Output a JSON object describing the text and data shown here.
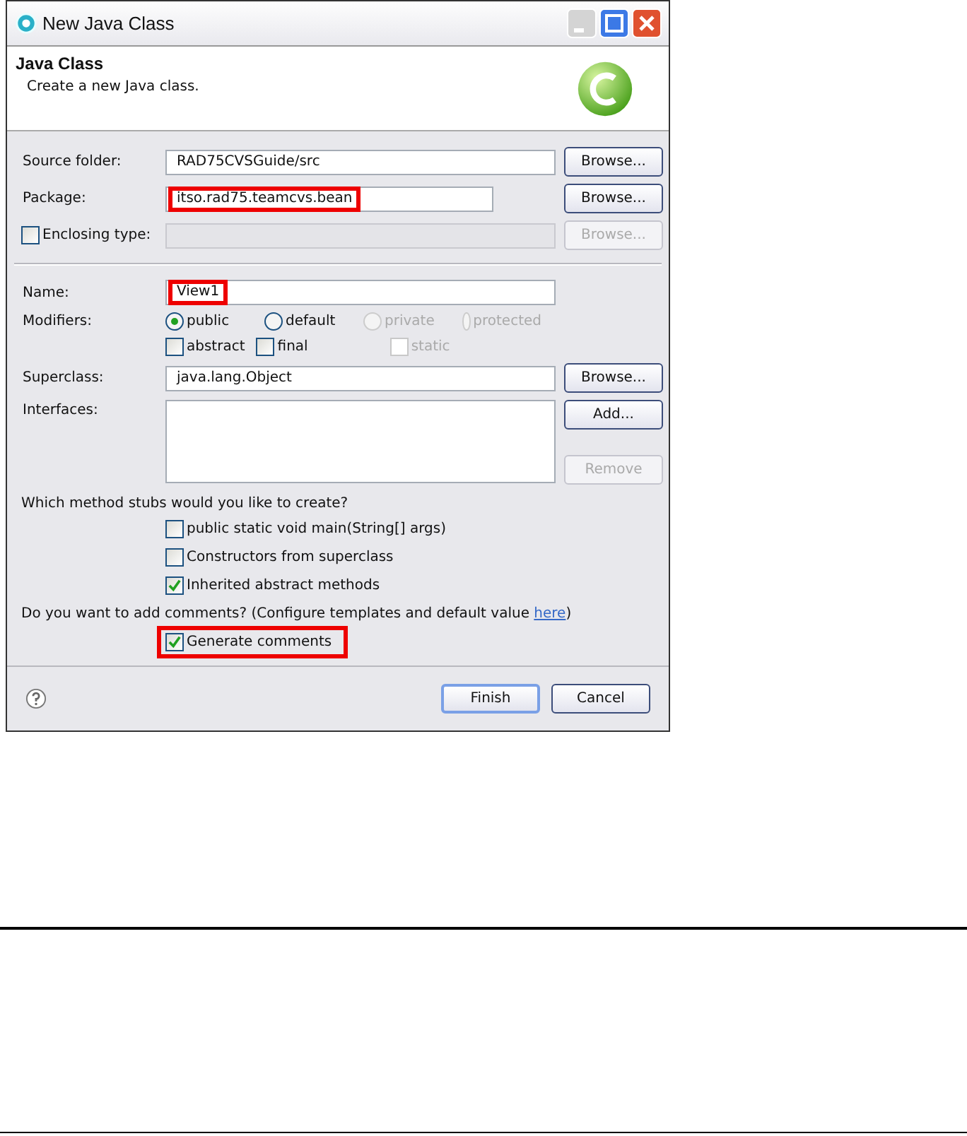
{
  "window": {
    "title": "New Java Class"
  },
  "header": {
    "title": "Java Class",
    "description": "Create a new Java class."
  },
  "location_fields": [
    {
      "kind": "text",
      "label": "Source folder:",
      "value": "RAD75CVSGuide/src",
      "highlighted": false,
      "button": {
        "label": "Browse...",
        "disabled": false
      }
    },
    {
      "kind": "text",
      "label": "Package:",
      "value": "itso.rad75.teamcvs.bean",
      "highlighted": true,
      "button": {
        "label": "Browse...",
        "disabled": false
      }
    },
    {
      "kind": "check",
      "label": "Enclosing type:",
      "checked": false,
      "disabled": true,
      "button": {
        "label": "Browse...",
        "disabled": true
      }
    }
  ],
  "name": {
    "label": "Name:",
    "value": "View1",
    "highlighted": true
  },
  "modifiers": {
    "label": "Modifiers:",
    "radios": [
      {
        "label": "public",
        "selected": true,
        "disabled": false
      },
      {
        "label": "default",
        "selected": false,
        "disabled": false
      },
      {
        "label": "private",
        "selected": false,
        "disabled": true
      },
      {
        "label": "protected",
        "selected": false,
        "disabled": true
      }
    ],
    "checks": [
      {
        "label": "abstract",
        "checked": false,
        "disabled": false
      },
      {
        "label": "final",
        "checked": false,
        "disabled": false
      },
      {
        "label": "static",
        "checked": false,
        "disabled": true
      }
    ]
  },
  "superclass": {
    "label": "Superclass:",
    "value": "java.lang.Object",
    "button": {
      "label": "Browse...",
      "disabled": false
    }
  },
  "interfaces": {
    "label": "Interfaces:",
    "buttons": [
      {
        "label": "Add...",
        "disabled": false
      },
      {
        "label": "Remove",
        "disabled": true
      }
    ]
  },
  "stubs": {
    "question": "Which method stubs would you like to create?",
    "options": [
      {
        "label": "public static void main(String[] args)",
        "checked": false
      },
      {
        "label": "Constructors from superclass",
        "checked": false
      },
      {
        "label": "Inherited abstract methods",
        "checked": true
      }
    ]
  },
  "comments": {
    "prompt": "Do you want to add comments? (Configure templates and default value ",
    "link": "here",
    "suffix": ")",
    "option": {
      "label": "Generate comments",
      "checked": true,
      "highlighted": true
    }
  },
  "footer": {
    "buttons": [
      {
        "label": "Finish",
        "default": true
      },
      {
        "label": "Cancel",
        "default": false
      }
    ]
  }
}
